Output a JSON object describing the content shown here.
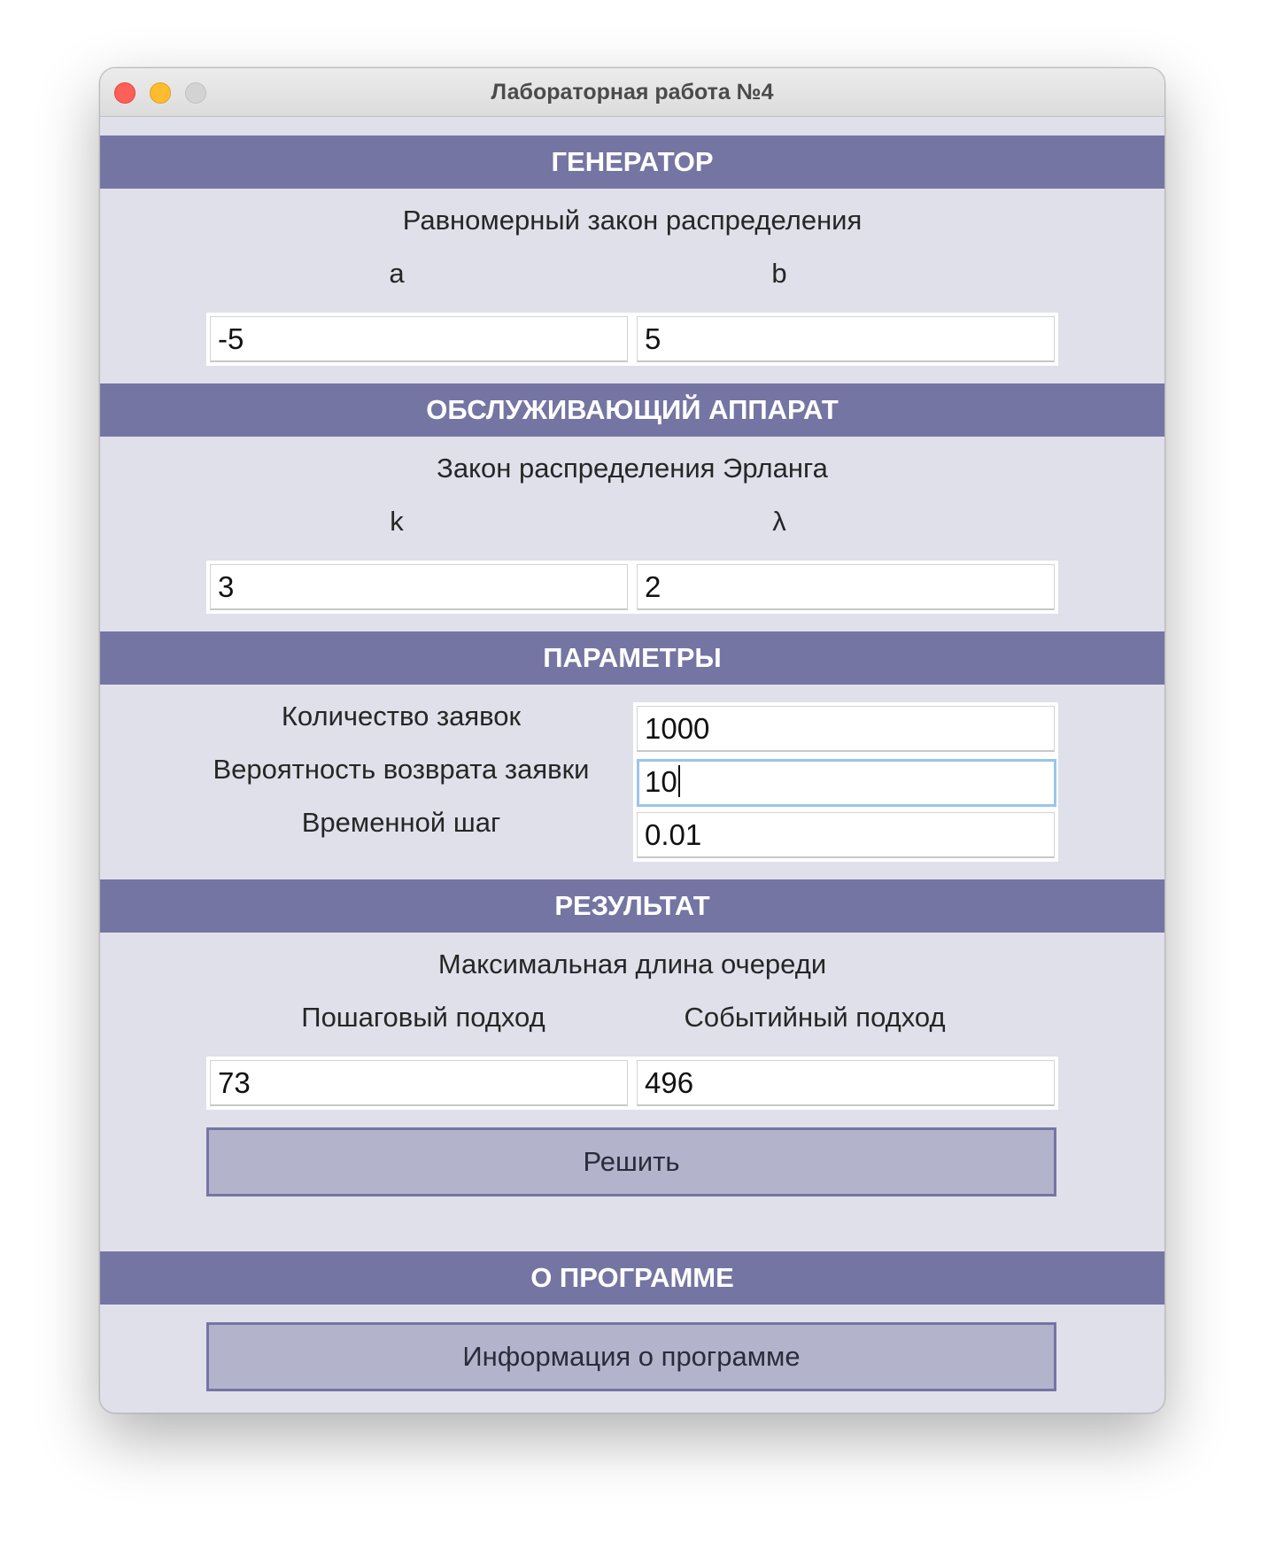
{
  "window": {
    "title": "Лабораторная работа №4"
  },
  "generator": {
    "header": "ГЕНЕРАТОР",
    "law": "Равномерный закон распределения",
    "param_a_label": "a",
    "param_b_label": "b",
    "a_value": "-5",
    "b_value": "5"
  },
  "server": {
    "header": "ОБСЛУЖИВАЮЩИЙ АППАРАТ",
    "law": "Закон распределения Эрланга",
    "param_k_label": "k",
    "param_lambda_label": "λ",
    "k_value": "3",
    "lambda_value": "2"
  },
  "params": {
    "header": "ПАРАМЕТРЫ",
    "requests_label": "Количество заявок",
    "requests_value": "1000",
    "return_prob_label": "Вероятность возврата заявки",
    "return_prob_value": "10",
    "time_step_label": "Временной шаг",
    "time_step_value": "0.01"
  },
  "result": {
    "header": "РЕЗУЛЬТАТ",
    "title": "Максимальная длина очереди",
    "step_label": "Пошаговый подход",
    "event_label": "Событийный подход",
    "step_value": "73",
    "event_value": "496",
    "solve_button": "Решить"
  },
  "about": {
    "header": "О ПРОГРАММЕ",
    "info_button": "Информация о программе"
  },
  "colors": {
    "header_bg": "#7575a3",
    "window_bg": "#e0e0eb",
    "button_bg": "#b3b3cc",
    "focus_ring": "#9bc4ee"
  }
}
